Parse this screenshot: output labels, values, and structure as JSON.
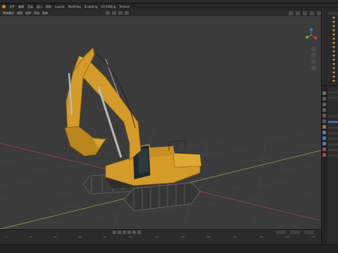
{
  "app": {
    "menu": [
      "文件",
      "编辑",
      "渲染",
      "窗口",
      "帮助",
      "Layout",
      "Modeling",
      "Sculpting",
      "UV Editing",
      "Texture"
    ]
  },
  "viewport": {
    "header": [
      "物体模式",
      "视图",
      "选择",
      "添加",
      "物体"
    ],
    "colors": {
      "background": "#3b3b3b",
      "grid_line": "#454545",
      "axis_x": "#9a3a45",
      "axis_y": "#7f9a3a",
      "excavator_yellow": "#d49a2a",
      "track": "#3a3a3a",
      "cab_glass": "#1e2a2e"
    },
    "gizmo_icons": [
      "x-axis-icon",
      "y-axis-icon",
      "z-axis-icon"
    ],
    "nav_icons": [
      "zoom-icon",
      "pan-icon",
      "camera-icon",
      "ortho-icon"
    ]
  },
  "timeline": {
    "ruler_ticks": [
      "0",
      "20",
      "40",
      "60",
      "80",
      "100",
      "120",
      "140",
      "160",
      "180",
      "200",
      "220",
      "240"
    ]
  }
}
